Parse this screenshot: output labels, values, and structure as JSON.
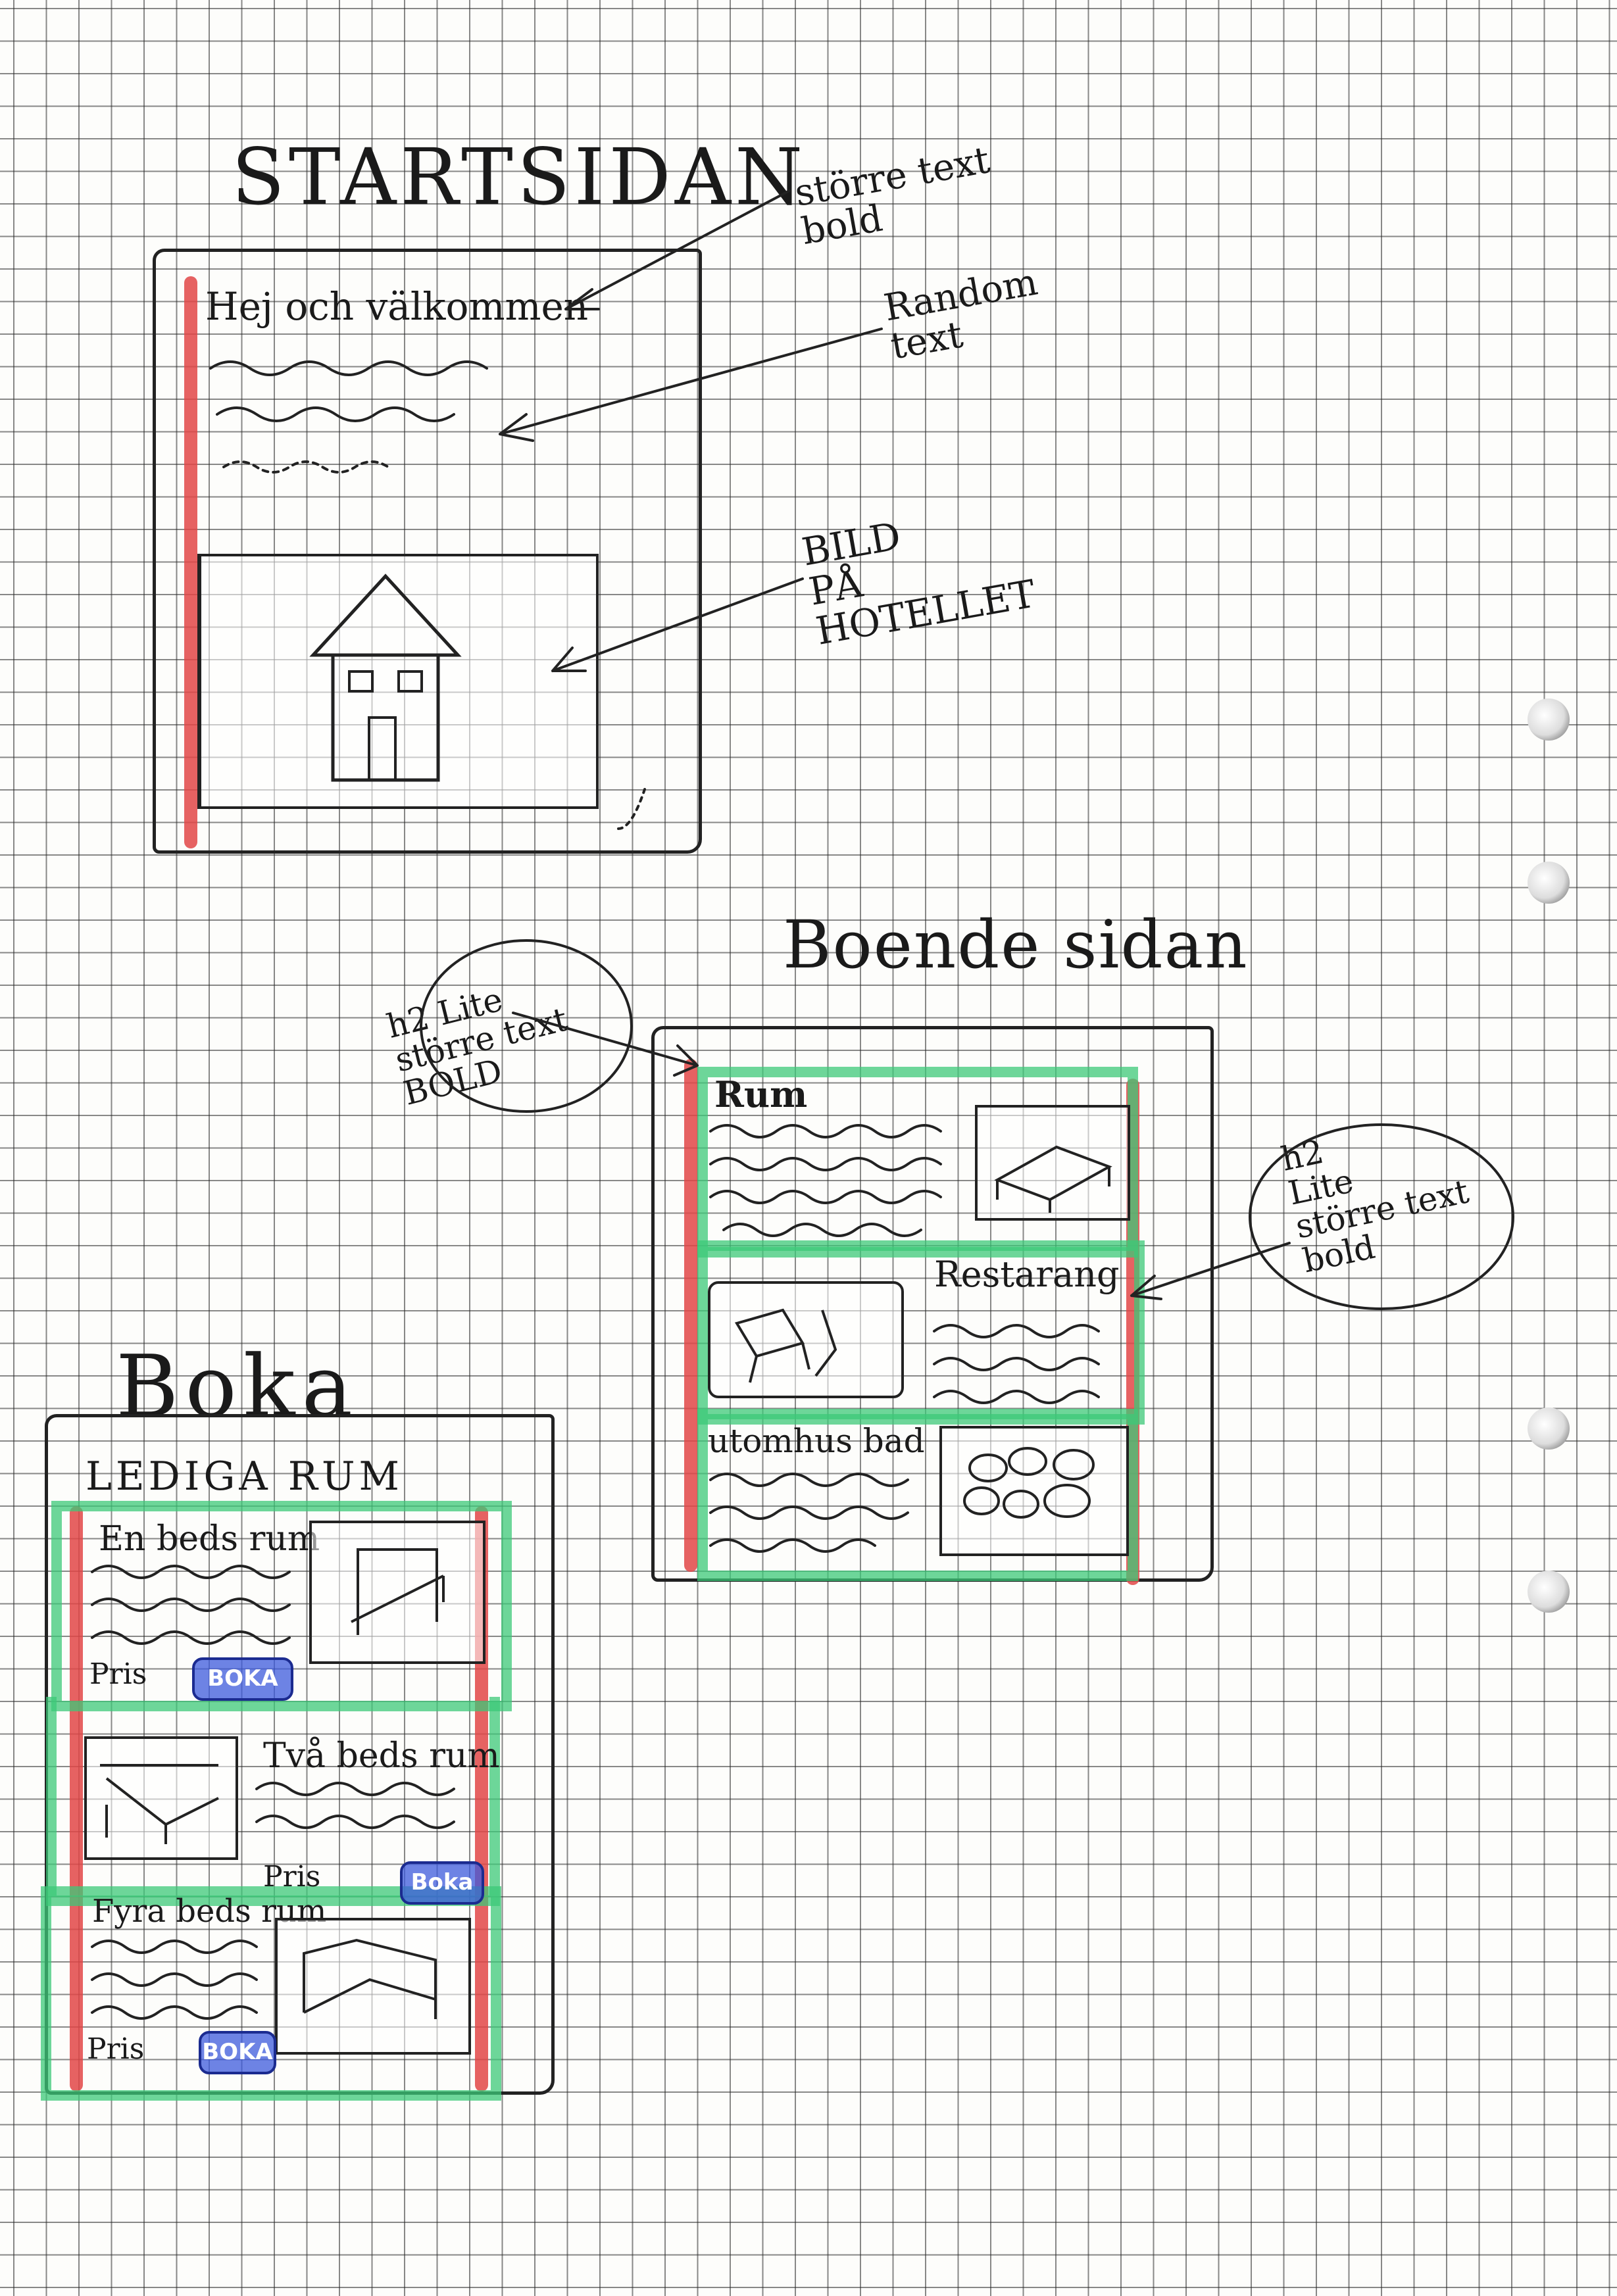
{
  "startsidan": {
    "heading": "STARTSIDAN",
    "welcome_text": "Hej och välkommen",
    "note_bigger_text": "större text\nbold",
    "note_random_text": "Random\ntext",
    "note_image": "BILD\nPÅ\nHOTELLET"
  },
  "boende": {
    "heading": "Boende sidan",
    "note_left": "h2 Lite\nstörre text\nBOLD",
    "note_right": "h2\nLite\nstörre text\nbold",
    "section_rooms": "Rum",
    "section_restaurant": "Restarang",
    "section_outdoor": "utomhus bad"
  },
  "boka": {
    "heading": "Boka",
    "subheading": "LEDIGA RUM",
    "rooms": [
      {
        "name": "En beds rum",
        "price_label": "Pris",
        "button": "BOKA"
      },
      {
        "name": "Två beds rum",
        "price_label": "Pris",
        "button": "Boka"
      },
      {
        "name": "Fyra beds rum",
        "price_label": "Pris",
        "button": "BOKA"
      }
    ]
  },
  "colors": {
    "red_marker": "#e24646",
    "green_marker": "#3cc878",
    "blue_marker": "#3c5adc"
  }
}
